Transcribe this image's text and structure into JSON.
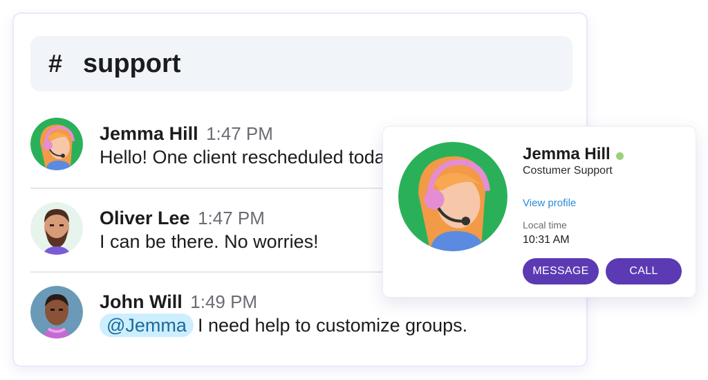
{
  "channel": {
    "hash": "#",
    "name": "support"
  },
  "messages": [
    {
      "author": "Jemma Hill",
      "time": "1:47 PM",
      "text": "Hello! One client rescheduled today",
      "avatar_icon": "woman-headset-avatar"
    },
    {
      "author": "Oliver Lee",
      "time": "1:47 PM",
      "text": "I can be there. No worries!",
      "avatar_icon": "bearded-man-avatar"
    },
    {
      "author": "John Will",
      "time": "1:49 PM",
      "mention": "@Jemma",
      "text": "I need help to customize groups.",
      "avatar_icon": "man-avatar"
    }
  ],
  "profile": {
    "name": "Jemma Hill",
    "role": "Costumer Support",
    "view_profile": "View profile",
    "local_time_label": "Local time",
    "local_time": "10:31 AM",
    "status": "online",
    "message_button": "MESSAGE",
    "call_button": "CALL"
  },
  "colors": {
    "accent": "#5b3ab3",
    "link": "#2a8bd8",
    "online": "#9ad07a",
    "mention_bg": "#cdeeff",
    "avatar_green": "#2bb05a"
  }
}
